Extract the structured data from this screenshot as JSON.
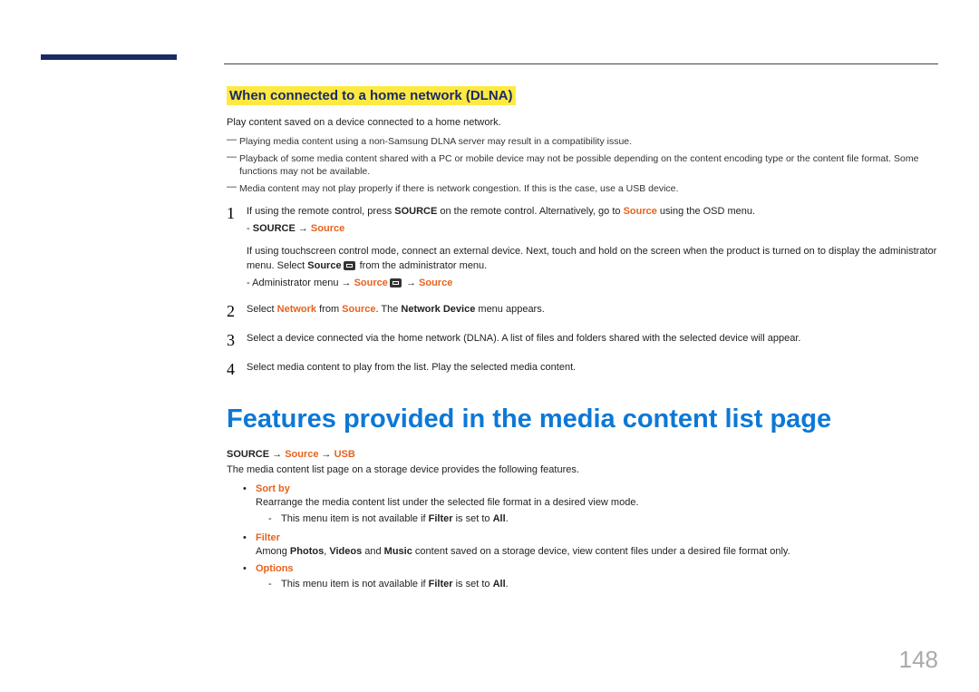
{
  "section": {
    "heading": "When connected to a home network (DLNA)",
    "intro": "Play content saved on a device connected to a home network.",
    "notes": [
      "Playing media content using a non-Samsung DLNA server may result in a compatibility issue.",
      "Playback of some media content shared with a PC or mobile device may not be possible depending on the content encoding type or the content file format. Some functions may not be available.",
      "Media content may not play properly if there is network congestion. If this is the case, use a USB device."
    ],
    "steps": {
      "s1": {
        "num": "1",
        "line1a": "If using the remote control, press ",
        "line1b": "SOURCE",
        "line1c": " on the remote control. Alternatively, go to ",
        "line1d": "Source",
        "line1e": " using the OSD menu.",
        "sub1a": "- ",
        "sub1b": "SOURCE",
        "sub1c": " → ",
        "sub1d": "Source",
        "line2a": "If using touchscreen control mode, connect an external device. Next, touch and hold on the screen when the product is turned on to display the administrator menu. Select ",
        "line2b": "Source",
        "line2c": " from the administrator menu.",
        "sub2a": "- Administrator menu → ",
        "sub2b": "Source",
        "sub2c": " → ",
        "sub2d": "Source"
      },
      "s2": {
        "num": "2",
        "a": "Select ",
        "b": "Network",
        "c": " from ",
        "d": "Source",
        "e": ". The ",
        "f": "Network Device",
        "g": " menu appears."
      },
      "s3": {
        "num": "3",
        "text": "Select a device connected via the home network (DLNA). A list of files and folders shared with the selected device will appear."
      },
      "s4": {
        "num": "4",
        "text": "Select media content to play from the list. Play the selected media content."
      }
    }
  },
  "features": {
    "heading": "Features provided in the media content list page",
    "path": {
      "a": "SOURCE",
      "b": " → ",
      "c": "Source",
      "d": " → ",
      "e": "USB"
    },
    "intro": "The media content list page on a storage device provides the following features.",
    "items": [
      {
        "title": "Sort by",
        "desc": "Rearrange the media content list under the selected file format in a desired view mode.",
        "note_a": "This menu item is not available if ",
        "note_b": "Filter",
        "note_c": " is set to ",
        "note_d": "All",
        "note_e": "."
      },
      {
        "title": "Filter",
        "desc_a": "Among ",
        "desc_b": "Photos",
        "desc_c": ", ",
        "desc_d": "Videos",
        "desc_e": " and ",
        "desc_f": "Music",
        "desc_g": " content saved on a storage device, view content files under a desired file format only."
      },
      {
        "title": "Options",
        "note_a": "This menu item is not available if ",
        "note_b": "Filter",
        "note_c": " is set to ",
        "note_d": "All",
        "note_e": "."
      }
    ]
  },
  "page_number": "148"
}
